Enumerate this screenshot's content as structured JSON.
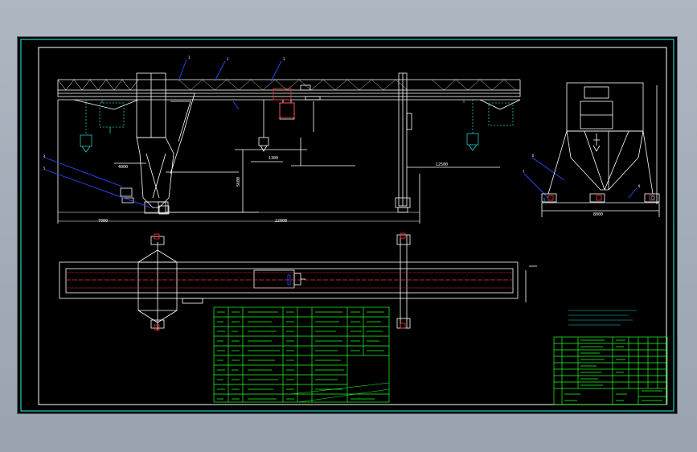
{
  "dimensions": {
    "left_span": "7000",
    "main_span": "22000",
    "side_width": "4000",
    "hook_height": "5600",
    "leg_height": "1300",
    "side_base": "8000",
    "plan_width": "12500"
  },
  "balloons": [
    "1",
    "2",
    "3",
    "4",
    "5",
    "6",
    "7",
    "8"
  ],
  "colors": {
    "background": "#000000",
    "lines": "#ffffff",
    "table": "#22ff22",
    "callouts": "#2a4cff",
    "hooks": "#22c6c6",
    "accent": "#ff3333",
    "sheet_border": "#20d0c0"
  }
}
